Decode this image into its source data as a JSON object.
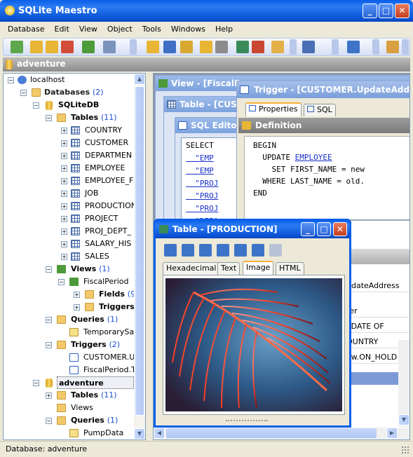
{
  "window": {
    "title": "SQLite Maestro"
  },
  "menu": [
    "Database",
    "Edit",
    "View",
    "Object",
    "Tools",
    "Windows",
    "Help"
  ],
  "db_bar": {
    "title": "adventure"
  },
  "tree": {
    "localhost": "localhost",
    "databases": "Databases",
    "databases_count": "(2)",
    "sqlitedb": "SQLiteDB",
    "tables": "Tables",
    "tables_count": "(11)",
    "table_items": [
      "COUNTRY",
      "CUSTOMER",
      "DEPARTMEN",
      "EMPLOYEE",
      "EMPLOYEE_F",
      "JOB",
      "PRODUCTION",
      "PROJECT",
      "PROJ_DEPT_",
      "SALARY_HIS",
      "SALES"
    ],
    "views": "Views",
    "views_count": "(1)",
    "fiscal": "FiscalPeriod",
    "fields": "Fields",
    "fields_count": "(9)",
    "triggers_sub": "Triggers",
    "queries": "Queries",
    "queries_count": "(1)",
    "tempsav": "TemporarySav",
    "triggers": "Triggers",
    "triggers_count": "(2)",
    "trig1": "CUSTOMER.U",
    "trig2": "FiscalPeriod.Tr",
    "adventure": "adventure",
    "adv_tables": "Tables",
    "adv_tables_count": "(11)",
    "adv_views": "Views",
    "adv_queries": "Queries",
    "adv_queries_count": "(1)",
    "pumpdata": "PumpData"
  },
  "mdi": {
    "view_title": "View - [FiscalPe",
    "table_title": "Table - [CUS",
    "sql_title": "SQL Editor",
    "trigger_title": "Trigger - [CUSTOMER.UpdateAdd",
    "trigger_tabs": [
      "Properties",
      "SQL"
    ],
    "definition": "Definition",
    "prod_title": "Table - [PRODUCTION]",
    "prod_tabs": [
      "Hexadecimal",
      "Text",
      "Image",
      "HTML"
    ],
    "right_rows": [
      "pdateAddress",
      "ter",
      "PDATE OF",
      "OUNTRY",
      "ew.ON_HOLD"
    ]
  },
  "sql_lines": [
    "SELECT",
    "  \"EMP",
    "  \"EMP",
    "  \"PROJ",
    "  \"PROJ",
    "  \"PROJ",
    "  \"DEPA"
  ],
  "trigger_code": {
    "l1": "BEGIN",
    "l2a": "  UPDATE ",
    "l2b": "EMPLOYEE",
    "l3": "    SET FIRST_NAME = new",
    "l4": "  WHERE LAST_NAME = old.",
    "l5": "END"
  },
  "status": {
    "text": "Database: adventure"
  }
}
